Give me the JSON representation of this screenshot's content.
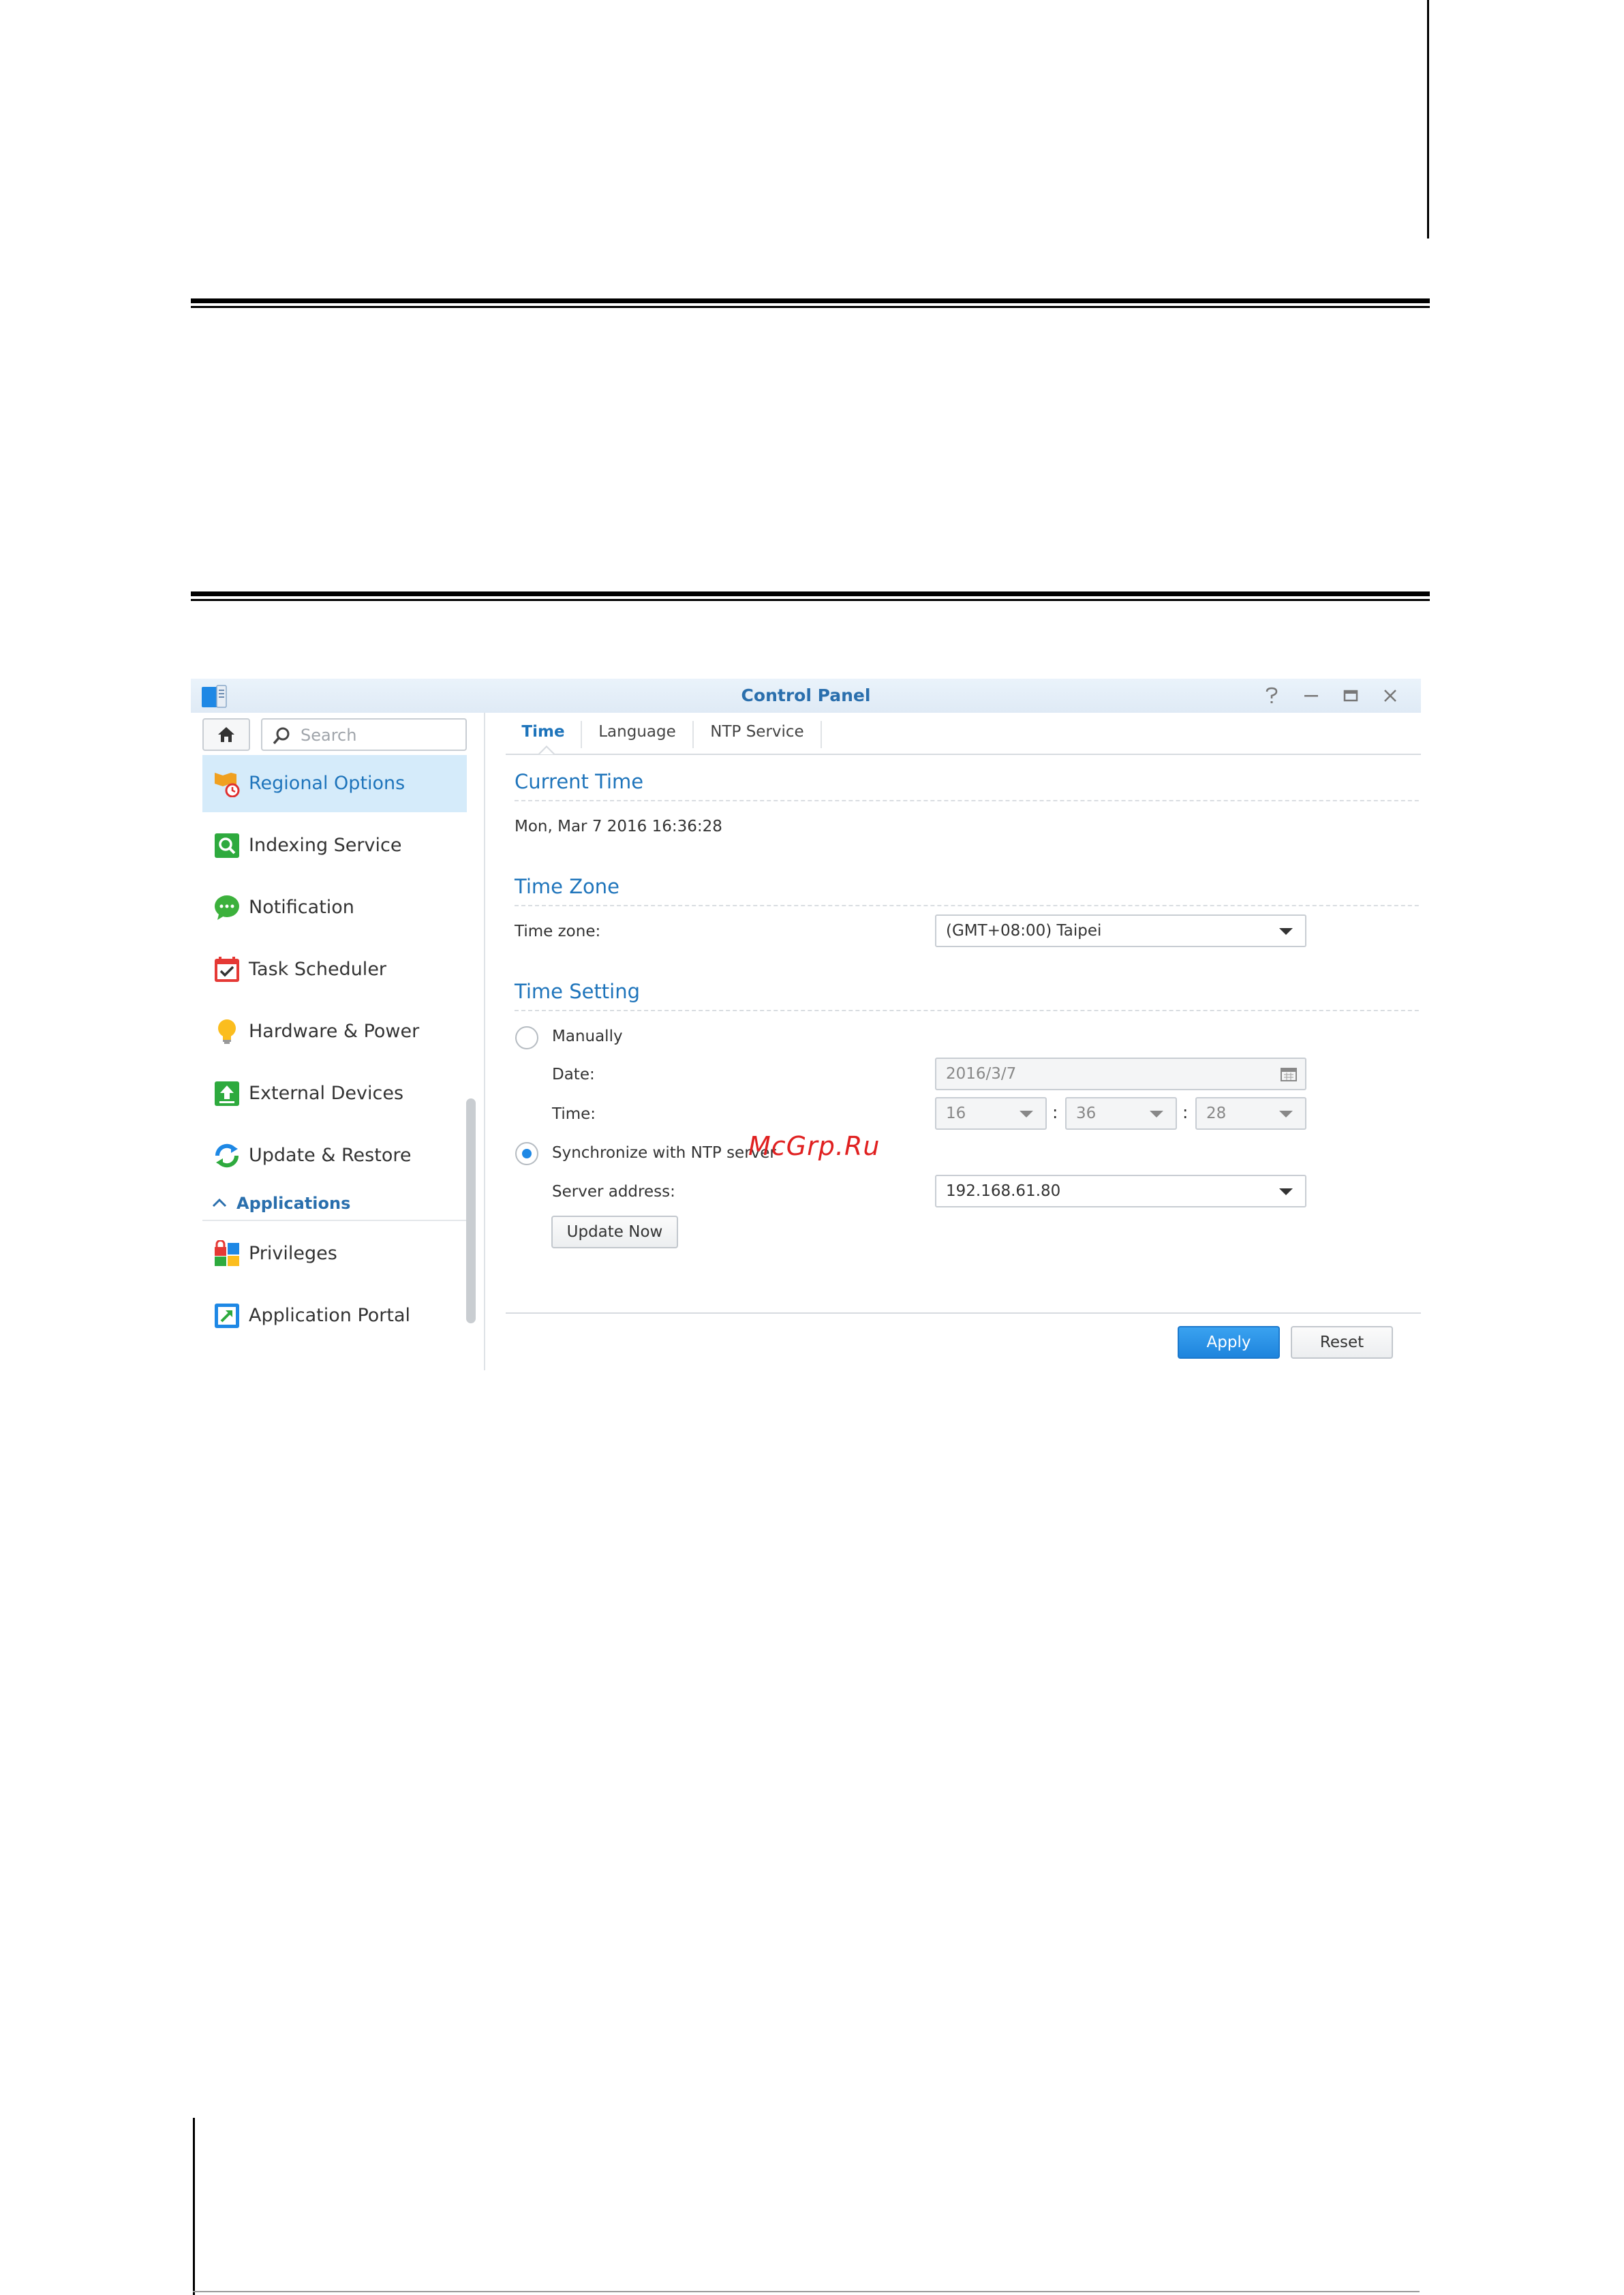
{
  "window": {
    "title": "Control Panel"
  },
  "sidebar": {
    "search_placeholder": "Search",
    "items": [
      {
        "label": "Regional Options",
        "icon": "regional-options-icon"
      },
      {
        "label": "Indexing Service",
        "icon": "indexing-service-icon"
      },
      {
        "label": "Notification",
        "icon": "notification-icon"
      },
      {
        "label": "Task Scheduler",
        "icon": "task-scheduler-icon"
      },
      {
        "label": "Hardware & Power",
        "icon": "lightbulb-icon"
      },
      {
        "label": "External Devices",
        "icon": "external-devices-icon"
      },
      {
        "label": "Update & Restore",
        "icon": "update-restore-icon"
      }
    ],
    "section_label": "Applications",
    "app_items": [
      {
        "label": "Privileges",
        "icon": "privileges-icon"
      },
      {
        "label": "Application Portal",
        "icon": "application-portal-icon"
      }
    ]
  },
  "tabs": [
    {
      "label": "Time",
      "active": true
    },
    {
      "label": "Language",
      "active": false
    },
    {
      "label": "NTP Service",
      "active": false
    }
  ],
  "current_time": {
    "title": "Current Time",
    "value": "Mon, Mar 7 2016 16:36:28"
  },
  "time_zone": {
    "title": "Time Zone",
    "label": "Time zone:",
    "value": "(GMT+08:00) Taipei"
  },
  "time_setting": {
    "title": "Time Setting",
    "manually_label": "Manually",
    "date_label": "Date:",
    "date_value": "2016/3/7",
    "time_label": "Time:",
    "hour": "16",
    "minute": "36",
    "second": "28",
    "colon": ":",
    "ntp_label": "Synchronize with NTP server",
    "server_label": "Server address:",
    "server_value": "192.168.61.80",
    "update_now": "Update Now"
  },
  "footer": {
    "apply": "Apply",
    "reset": "Reset"
  },
  "watermark": "McGrp.Ru",
  "colors": {
    "accent": "#1e74bb",
    "primary_button": "#2a92e6",
    "active_nav_bg": "#d5ebfa"
  }
}
